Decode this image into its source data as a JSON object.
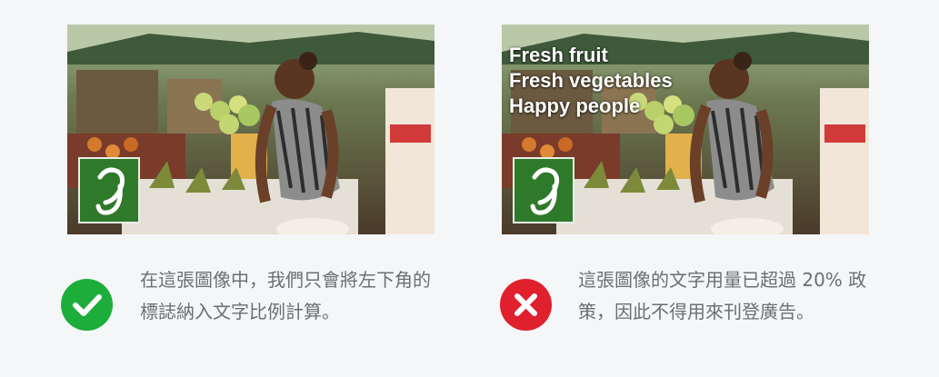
{
  "examples": [
    {
      "status": "approved",
      "status_icon": "check-circle-icon",
      "status_color": "#1dad3a",
      "image": {
        "logo_icon": "brand-logo-cursive-g",
        "logo_color": "#2f7a2a",
        "overlay_text": []
      },
      "caption": "在這張圖像中，我們只會將左下角的標誌納入文字比例計算。"
    },
    {
      "status": "rejected",
      "status_icon": "x-circle-icon",
      "status_color": "#e1202e",
      "image": {
        "logo_icon": "brand-logo-cursive-g",
        "logo_color": "#2f7a2a",
        "overlay_text": [
          "Fresh fruit",
          "Fresh vegetables",
          "Happy people"
        ]
      },
      "caption": "這張圖像的文字用量已超過 20% 政策，因此不得用來刊登廣告。"
    }
  ]
}
